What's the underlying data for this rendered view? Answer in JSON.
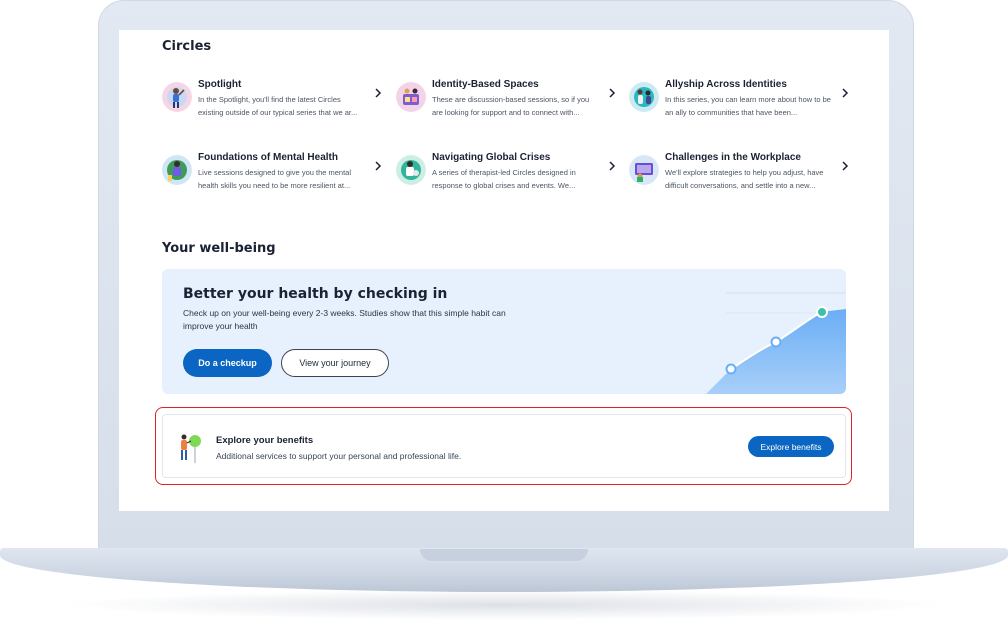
{
  "circles": {
    "title": "Circles",
    "items": [
      {
        "name": "Spotlight",
        "description": "In the Spotlight, you'll find the latest Circles existing outside of our typical series that we ar...",
        "icon": "spotlight-illustration"
      },
      {
        "name": "Identity-Based Spaces",
        "description": "These are discussion-based sessions, so if you are looking for support and to connect with...",
        "icon": "identity-illustration"
      },
      {
        "name": "Allyship Across Identities",
        "description": "In this series, you can learn more about how to be an ally to communities that have been...",
        "icon": "allyship-illustration"
      },
      {
        "name": "Foundations of Mental Health",
        "description": "Live sessions designed to give you the mental health skills you need to be more resilient at...",
        "icon": "mental-health-illustration"
      },
      {
        "name": "Navigating Global Crises",
        "description": "A series of therapist-led Circles designed in response to global crises and events. We...",
        "icon": "global-crises-illustration"
      },
      {
        "name": "Challenges in the Workplace",
        "description": "We'll explore strategies to help you adjust, have difficult conversations, and settle into a new...",
        "icon": "workplace-illustration"
      }
    ]
  },
  "wellbeing": {
    "title": "Your well-being",
    "card": {
      "title": "Better your health by checking in",
      "text": "Check up on your well-being every 2-3 weeks. Studies show that this simple habit can improve your health",
      "primary_label": "Do a checkup",
      "secondary_label": "View your journey"
    }
  },
  "benefits": {
    "title": "Explore your benefits",
    "text": "Additional services to support your personal and professional life.",
    "button_label": "Explore benefits"
  },
  "colors": {
    "accent": "#0a66c2",
    "card_bg": "#e6f1fd",
    "highlight": "#e02424"
  }
}
